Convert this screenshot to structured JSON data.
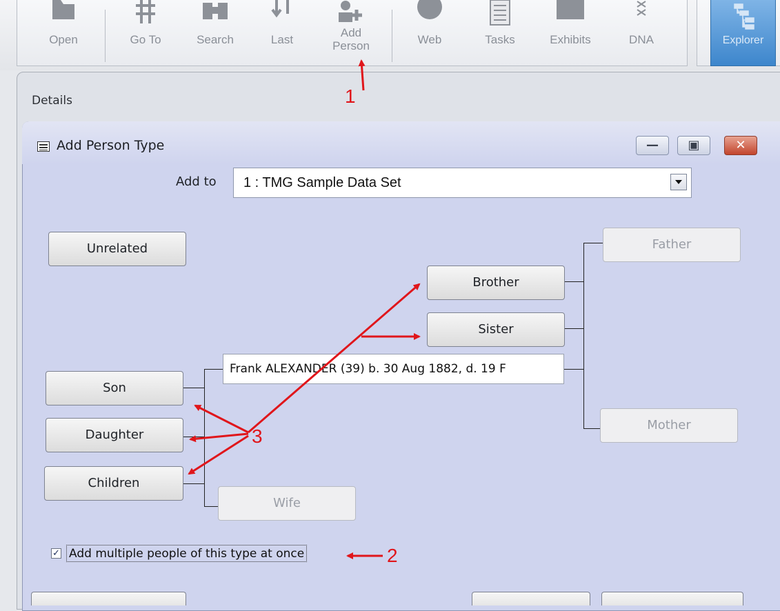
{
  "toolbar": {
    "buttons": [
      {
        "label": "Open",
        "icon": "folder-icon"
      },
      {
        "label": "Go To",
        "icon": "hash-icon"
      },
      {
        "label": "Search",
        "icon": "binoculars-icon"
      },
      {
        "label": "Last",
        "icon": "arrows-icon"
      },
      {
        "label": "Add\nPerson",
        "icon": "add-person-icon"
      },
      {
        "label": "Web",
        "icon": "globe-icon"
      },
      {
        "label": "Tasks",
        "icon": "tasks-icon"
      },
      {
        "label": "Exhibits",
        "icon": "exhibits-icon"
      },
      {
        "label": "DNA",
        "icon": "dna-icon"
      }
    ],
    "explorer_label": "Explorer"
  },
  "details": {
    "title": "Details"
  },
  "dialog": {
    "title": "Add Person Type",
    "add_to_label": "Add to",
    "add_to_value": "1 : TMG Sample Data Set",
    "person_text": "Frank ALEXANDER (39) b. 30 Aug 1882, d. 19 F",
    "relations": {
      "unrelated": "Unrelated",
      "father": "Father",
      "mother": "Mother",
      "brother": "Brother",
      "sister": "Sister",
      "son": "Son",
      "daughter": "Daughter",
      "children": "Children",
      "wife": "Wife"
    },
    "multiple_checkbox_label": "Add multiple people of this type at once",
    "multiple_checked": true
  },
  "annotations": {
    "one": "1",
    "two": "2",
    "three": "3"
  },
  "colors": {
    "annotation_red": "#e0161b",
    "dialog_bg": "#cfd4ee",
    "explorer_blue": "#3d86cc"
  }
}
